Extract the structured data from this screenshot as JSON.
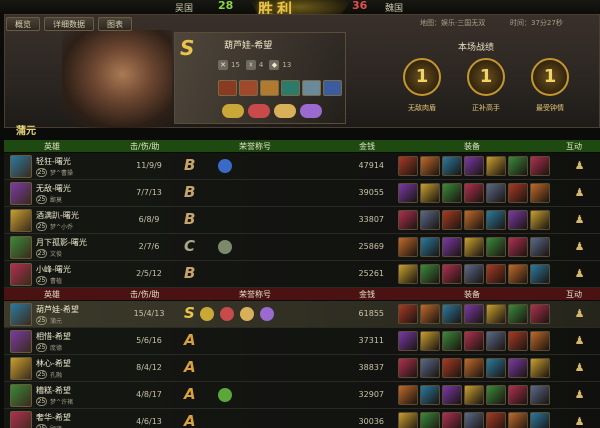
{
  "topbar": {
    "team_left": "吴国",
    "score_left": "28",
    "team_right": "魏国",
    "score_right": "36",
    "result": "胜利"
  },
  "tabs": [
    "概览",
    "详细数据",
    "图表"
  ],
  "map_text": "地图：娱乐·三国无双",
  "time_text": "时间：37分27秒",
  "header": {
    "grade": "S",
    "hero": "葫芦娃-希望",
    "stats": [
      "15",
      "4",
      "13"
    ],
    "player_tag": "蒲元"
  },
  "honor_title": "本场战绩",
  "medals": [
    {
      "label": "无敌肉盾"
    },
    {
      "label": "正补高手"
    },
    {
      "label": "最受钟情"
    }
  ],
  "medal_icon": "1",
  "columns": {
    "hero": "英雄",
    "kda": "击/伤/助",
    "title": "荣誉称号",
    "gold": "金钱",
    "gear": "装备",
    "inter": "互动"
  },
  "team1": [
    {
      "hero": "轻狂-曙光",
      "lvl": "25",
      "player": "梦^曹操",
      "kda": "11/9/9",
      "grade": "B",
      "gold": "47914"
    },
    {
      "hero": "无敌-曙光",
      "lvl": "25",
      "player": "鄙莫",
      "kda": "7/7/13",
      "grade": "B",
      "gold": "39055"
    },
    {
      "hero": "酒满趴-曙光",
      "lvl": "25",
      "player": "梦^小乔",
      "kda": "6/8/9",
      "grade": "B",
      "gold": "33807"
    },
    {
      "hero": "月下孤影-曙光",
      "lvl": "23",
      "player": "文俊",
      "kda": "2/7/6",
      "grade": "C",
      "gold": "25869"
    },
    {
      "hero": "小峰-曙光",
      "lvl": "25",
      "player": "曹植",
      "kda": "2/5/12",
      "grade": "B",
      "gold": "25261"
    }
  ],
  "team2": [
    {
      "hero": "葫芦娃-希望",
      "lvl": "25",
      "player": "蒲元",
      "kda": "15/4/13",
      "grade": "S",
      "gold": "61855"
    },
    {
      "hero": "相惜-希望",
      "lvl": "25",
      "player": "庞德",
      "kda": "5/6/16",
      "grade": "A",
      "gold": "37311"
    },
    {
      "hero": "林心-希望",
      "lvl": "25",
      "player": "孔融",
      "kda": "8/4/12",
      "grade": "A",
      "gold": "38837"
    },
    {
      "hero": "糟糕-希望",
      "lvl": "25",
      "player": "梦^许褚",
      "kda": "4/8/17",
      "grade": "A",
      "gold": "32907"
    },
    {
      "hero": "奢华-希望",
      "lvl": "25",
      "player": "顾雍",
      "kda": "4/6/13",
      "grade": "A",
      "gold": "30036"
    }
  ]
}
